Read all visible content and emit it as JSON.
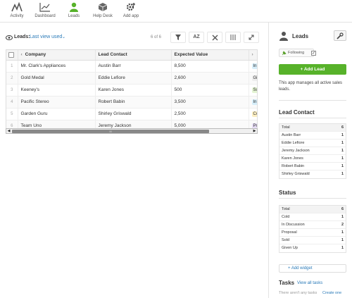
{
  "nav": {
    "items": [
      {
        "label": "Activity",
        "icon": "activity-icon"
      },
      {
        "label": "Dashboard",
        "icon": "dashboard-icon"
      },
      {
        "label": "Leads",
        "icon": "leads-icon",
        "active": true
      },
      {
        "label": "Help Desk",
        "icon": "help-desk-icon"
      },
      {
        "label": "Add app",
        "icon": "add-app-icon"
      }
    ]
  },
  "toolbar": {
    "app_label": "Leads:",
    "view_label": "Last view used",
    "count": "6 of 6",
    "sort_label": "AZ"
  },
  "table": {
    "columns": [
      "Company",
      "Lead Contact",
      "Expected Value"
    ],
    "rows": [
      {
        "num": "1",
        "company": "Mr. Clark's Appliances",
        "contact": "Austin Barr",
        "value": "8,500",
        "status": "In D"
      },
      {
        "num": "2",
        "company": "Gold Medal",
        "contact": "Eddie Lefiore",
        "value": "2,600",
        "status": "Give"
      },
      {
        "num": "3",
        "company": "Keeney's",
        "contact": "Karen Jones",
        "value": "500",
        "status": "Sold"
      },
      {
        "num": "4",
        "company": "Pacific Stereo",
        "contact": "Robert Babin",
        "value": "3,500",
        "status": "In D"
      },
      {
        "num": "5",
        "company": "Garden Guru",
        "contact": "Shirley Griswald",
        "value": "2,500",
        "status": "Cold"
      },
      {
        "num": "6",
        "company": "Team Uno",
        "contact": "Jeremy Jackson",
        "value": "5,000",
        "status": "Prop"
      }
    ],
    "scroll_label": "III"
  },
  "panel": {
    "title": "Leads",
    "following_label": "Following",
    "follow_check": "✓",
    "add_lead_label": "+ Add Lead",
    "description": "This app manages all active sales leads.",
    "lead_contact": {
      "title": "Lead Contact",
      "total_label": "Total",
      "total_value": "6",
      "items": [
        {
          "label": "Austin Barr",
          "value": "1"
        },
        {
          "label": "Eddie Lefiore",
          "value": "1"
        },
        {
          "label": "Jeremy Jackson",
          "value": "1"
        },
        {
          "label": "Karen Jones",
          "value": "1"
        },
        {
          "label": "Robert Babin",
          "value": "1"
        },
        {
          "label": "Shirley Griswald",
          "value": "1"
        }
      ]
    },
    "status": {
      "title": "Status",
      "total_label": "Total",
      "total_value": "6",
      "items": [
        {
          "label": "Cold",
          "value": "1"
        },
        {
          "label": "In Discussion",
          "value": "2"
        },
        {
          "label": "Proposal",
          "value": "1"
        },
        {
          "label": "Sold",
          "value": "1"
        },
        {
          "label": "Given Up",
          "value": "1"
        }
      ]
    },
    "add_widget_label": "+ Add widget",
    "tasks": {
      "title": "Tasks",
      "view_all": "View all tasks",
      "empty_text": "There aren't any tasks",
      "create_link": "Create one"
    }
  },
  "colors": {
    "accent_green": "#57b22a",
    "link_blue": "#2a7ab8",
    "status_in_discussion": "#d6eefa",
    "status_given_up": "#eeeeee",
    "status_sold": "#e3f3d2",
    "status_cold": "#fbeec2",
    "status_proposal": "#e6dcf5"
  }
}
